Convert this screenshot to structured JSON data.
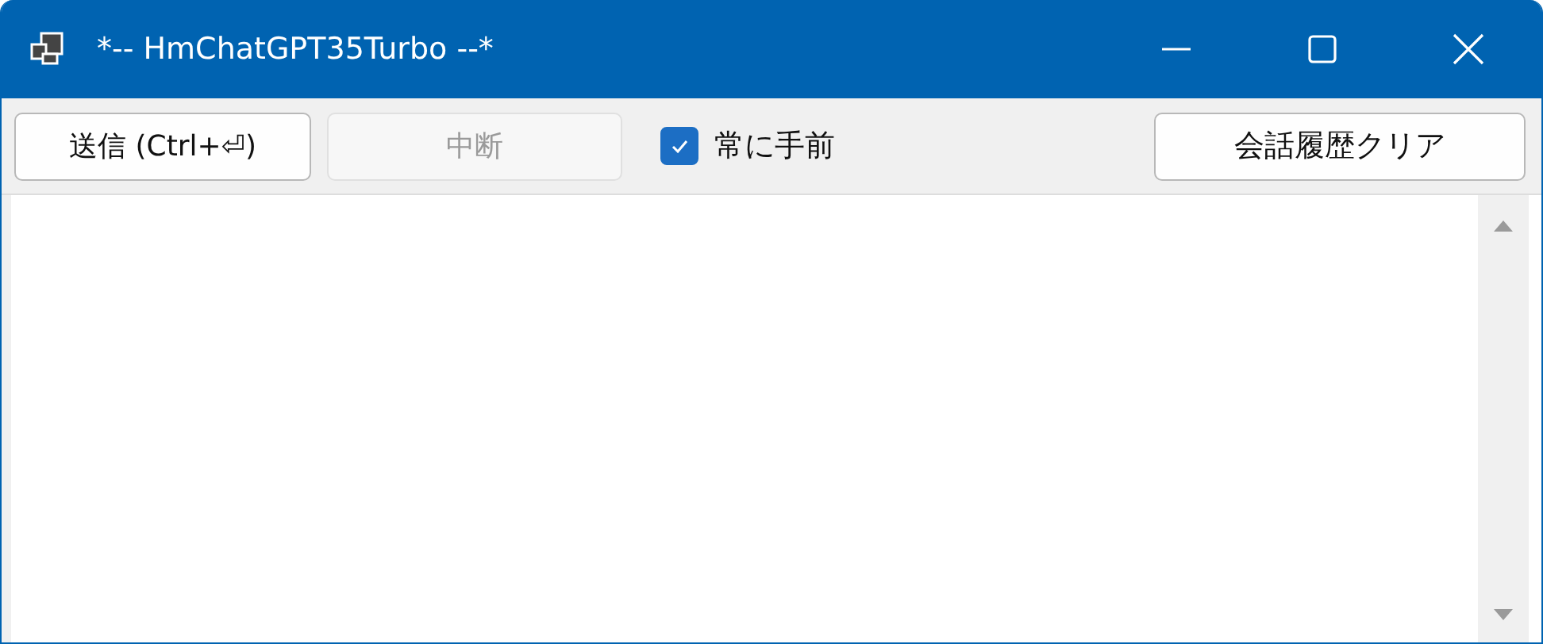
{
  "window": {
    "title": "*-- HmChatGPT35Turbo --*"
  },
  "toolbar": {
    "buttons": [
      {
        "label": "送信 (Ctrl+⏎)",
        "disabled": false
      },
      {
        "label": "中断",
        "disabled": true
      }
    ],
    "checkbox": {
      "label": "常に手前",
      "checked": true
    },
    "clear_button": {
      "label": "会話履歴クリア",
      "disabled": false
    }
  }
}
